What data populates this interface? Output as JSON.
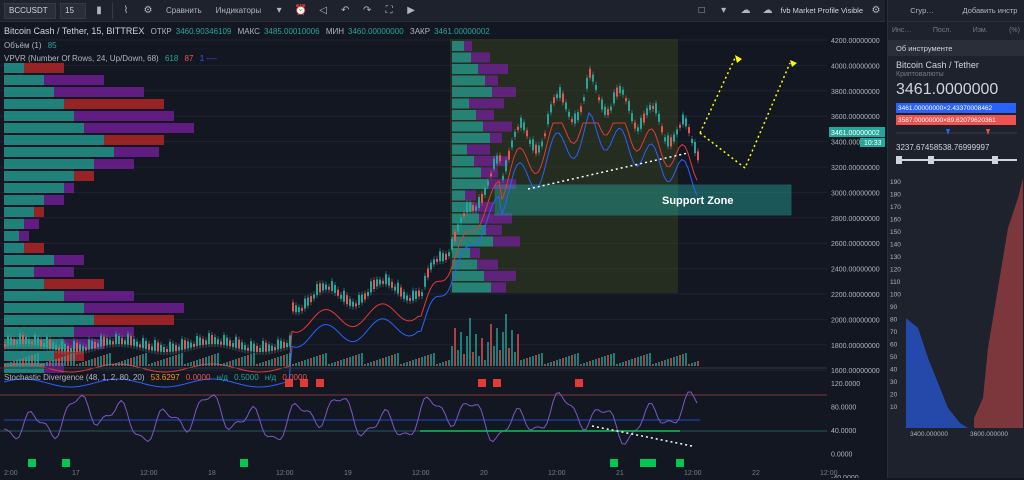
{
  "toolbar": {
    "symbol": "BCCUSDT",
    "interval": "15",
    "compare_label": "Сравнить",
    "indicators_label": "Индикаторы",
    "profile_label": "fvb Market Profile Visible"
  },
  "chart": {
    "title": "Bitcoin Cash / Tether, 15, BITTREX",
    "open_label": "ОТКР",
    "open_value": "3460.90346109",
    "high_label": "МАКС",
    "high_value": "3485.00010006",
    "low_label": "МИН",
    "low_value": "3460.00000000",
    "close_label": "ЗАКР",
    "close_value": "3461.00000002",
    "volume_label": "Объём (1)",
    "volume_value": "85",
    "vpvr_label": "VPVR (Number Of Rows, 24, Up/Down, 68)",
    "vpvr_v1": "618",
    "vpvr_v2": "87",
    "vpvr_v3": "1 ----",
    "stoch_label": "Stochastic Divergence (48, 1, 2, 80, 20)",
    "stoch_v1": "53.6297",
    "stoch_v2": "0.0000",
    "stoch_v3": "н/д",
    "stoch_v4": "0.5000",
    "stoch_v5": "н/д",
    "stoch_v6": "0.0000",
    "support_zone_label": "Support Zone",
    "price_tag": "3461.00000002",
    "time_tag": "10:33",
    "price_axis": [
      "4200.00000000",
      "4000.00000000",
      "3800.00000000",
      "3600.00000000",
      "3400.00000000",
      "3200.00000000",
      "3000.00000000",
      "2800.00000000",
      "2600.00000000",
      "2400.00000000",
      "2200.00000000",
      "2000.00000000",
      "1800.00000000",
      "1600.00000000"
    ],
    "osc_axis": [
      "120.0000",
      "80.0000",
      "40.0000",
      "0.0000",
      "-40.0000"
    ],
    "time_axis": [
      "2:00",
      "17",
      "12:00",
      "18",
      "12:00",
      "19",
      "12:00",
      "20",
      "12:00",
      "21",
      "12:00",
      "22",
      "12:00"
    ]
  },
  "panel": {
    "tab1": "Сгур…",
    "tab2": "Добавить инстр",
    "col1": "Инс…",
    "col2": "Посл.",
    "col3": "Изм.",
    "col4": "(%)",
    "section": "Об инструменте",
    "name": "Bitcoin Cash / Tether",
    "type": "Криптовалюты",
    "price": "3461.0000000",
    "bid": "3461.00000000×2.43370008462",
    "ask": "3587.00000000×89.62079620361",
    "range": "3237.67458538.76999997",
    "depth_y": [
      "190",
      "180",
      "170",
      "160",
      "150",
      "140",
      "130",
      "120",
      "110",
      "100",
      "90",
      "80",
      "70",
      "60",
      "50",
      "40",
      "30",
      "20",
      "10"
    ],
    "depth_x": [
      "3400.000000",
      "3600.000000"
    ]
  }
}
